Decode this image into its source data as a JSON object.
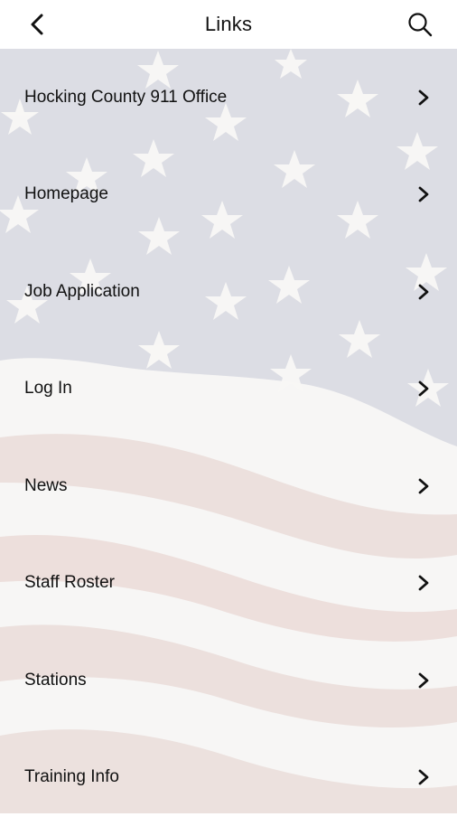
{
  "header": {
    "title": "Links",
    "back_icon": "chevron-left-icon",
    "search_icon": "search-icon"
  },
  "links": [
    {
      "label": "Hocking County 911 Office"
    },
    {
      "label": "Homepage"
    },
    {
      "label": "Job Application"
    },
    {
      "label": "Log In"
    },
    {
      "label": "News"
    },
    {
      "label": "Staff Roster"
    },
    {
      "label": "Stations"
    },
    {
      "label": "Training Info"
    }
  ],
  "colors": {
    "canton": "#dcdde4",
    "stripe_red": "#ece0dd",
    "stripe_white": "#f7f6f5",
    "star": "#f9f8f6",
    "text": "#111111"
  }
}
